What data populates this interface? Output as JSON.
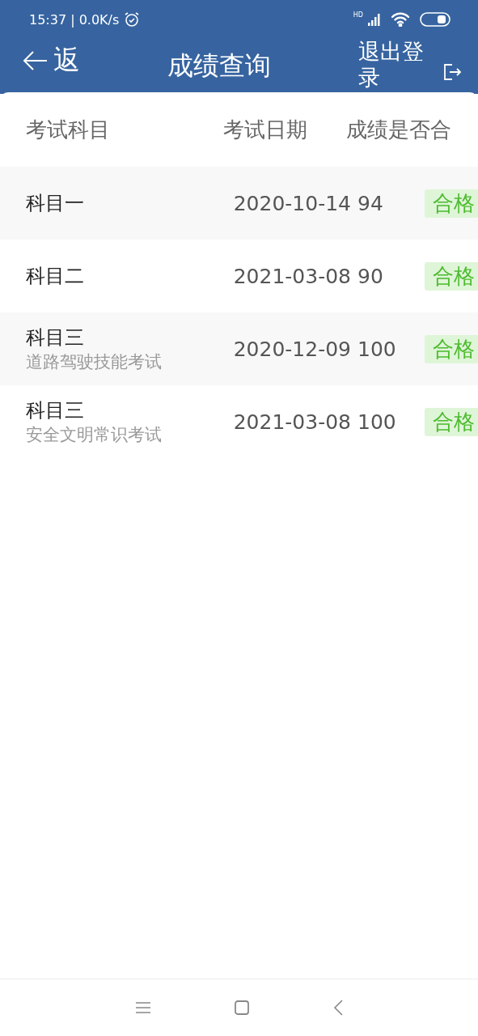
{
  "status_bar": {
    "time": "15:37 | 0.0K/s",
    "signal_badge": "HD"
  },
  "header": {
    "back_label": "返",
    "title": "成绩查询",
    "logout_label": "退出登录"
  },
  "table": {
    "columns": [
      "考试科目",
      "考试日期",
      "成绩是否合"
    ],
    "rows": [
      {
        "subject": "科目一",
        "detail": "",
        "date": "2020-10-14",
        "score": "94",
        "result": "合格",
        "passed": true
      },
      {
        "subject": "科目二",
        "detail": "",
        "date": "2021-03-08",
        "score": "90",
        "result": "合格",
        "passed": true
      },
      {
        "subject": "科目三",
        "detail": "道路驾驶技能考试",
        "date": "2020-12-09",
        "score": "100",
        "result": "合格",
        "passed": true
      },
      {
        "subject": "科目三",
        "detail": "安全文明常识考试",
        "date": "2021-03-08",
        "score": "100",
        "result": "合格",
        "passed": true
      }
    ]
  }
}
